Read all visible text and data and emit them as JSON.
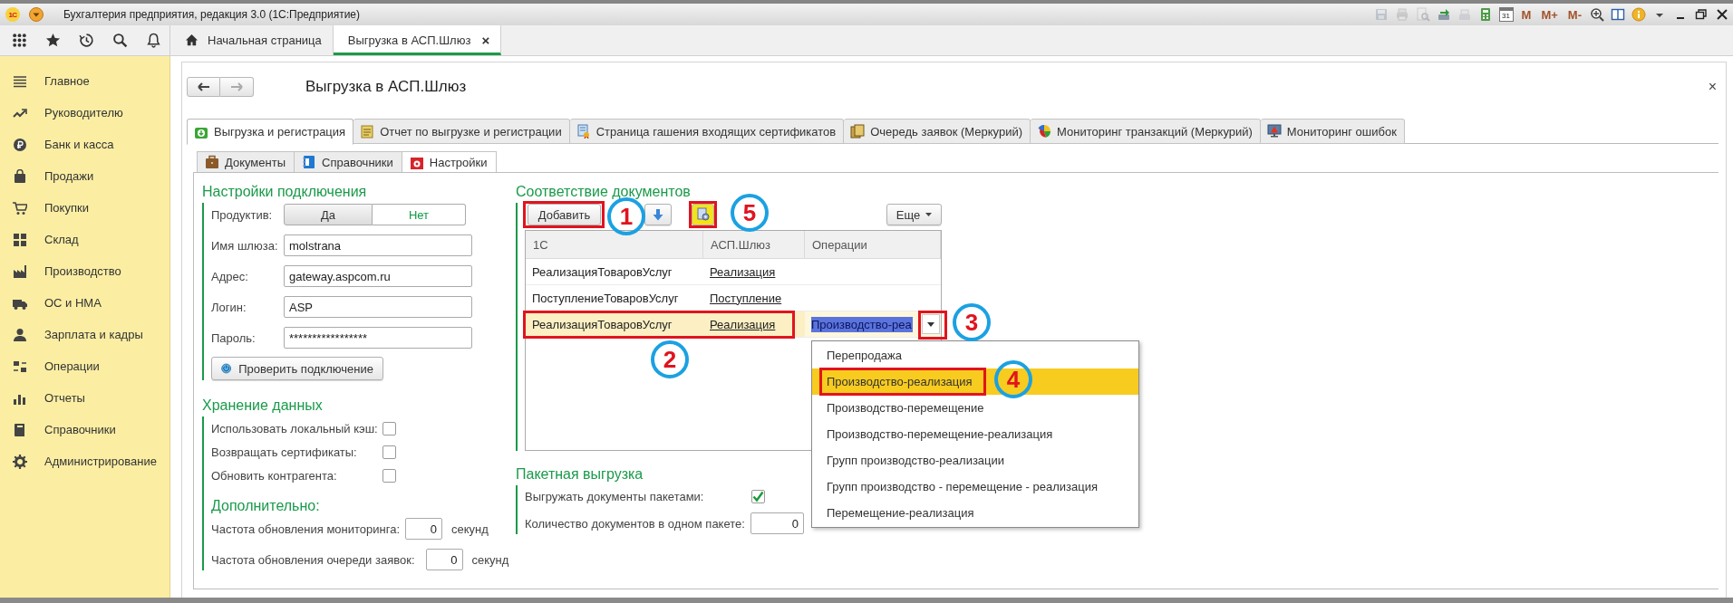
{
  "window": {
    "logo": "1С",
    "title": "Бухгалтерия предприятия, редакция 3.0  (1С:Предприятие)"
  },
  "toolbar": [
    {
      "kind": "save",
      "disabled": true
    },
    {
      "kind": "print",
      "disabled": true
    },
    {
      "kind": "preview",
      "disabled": true
    },
    {
      "kind": "send",
      "disabled": false
    },
    {
      "kind": "scan",
      "disabled": true
    },
    {
      "kind": "calculator",
      "disabled": false
    },
    {
      "kind": "calendar",
      "disabled": false,
      "text": "31"
    },
    {
      "kind": "memory",
      "disabled": false,
      "text": "M"
    },
    {
      "kind": "memory",
      "disabled": false,
      "text": "M+"
    },
    {
      "kind": "memory",
      "disabled": false,
      "text": "M-"
    },
    {
      "kind": "zoom",
      "disabled": false
    },
    {
      "kind": "panels",
      "disabled": false
    },
    {
      "kind": "info",
      "disabled": false
    },
    {
      "kind": "caret",
      "disabled": false
    },
    {
      "kind": "minimize",
      "disabled": false
    },
    {
      "kind": "restore",
      "disabled": false
    },
    {
      "kind": "close",
      "disabled": false
    }
  ],
  "open_tabs": [
    {
      "label": "Начальная страница",
      "kind": "home",
      "selected": false
    },
    {
      "label": "Выгрузка в АСП.Шлюз",
      "kind": "page",
      "selected": true,
      "close": "×"
    }
  ],
  "sidebar": {
    "items": [
      {
        "label": "Главное"
      },
      {
        "label": "Руководителю"
      },
      {
        "label": "Банк и касса"
      },
      {
        "label": "Продажи"
      },
      {
        "label": "Покупки"
      },
      {
        "label": "Склад"
      },
      {
        "label": "Производство"
      },
      {
        "label": "ОС и НМА"
      },
      {
        "label": "Зарплата и кадры"
      },
      {
        "label": "Операции"
      },
      {
        "label": "Отчеты"
      },
      {
        "label": "Справочники"
      },
      {
        "label": "Администрирование"
      }
    ]
  },
  "form": {
    "title": "Выгрузка в АСП.Шлюз",
    "close": "×",
    "tabs": [
      {
        "label": "Выгрузка и регистрация",
        "selected": true
      },
      {
        "label": "Отчет по выгрузке и регистрации",
        "selected": false
      },
      {
        "label": "Страница гашения входящих сертификатов",
        "selected": false
      },
      {
        "label": "Очередь заявок (Меркурий)",
        "selected": false
      },
      {
        "label": "Мониторинг транзакций (Меркурий)",
        "selected": false
      },
      {
        "label": "Мониторинг ошибок",
        "selected": false
      }
    ],
    "subtabs": [
      {
        "label": "Документы",
        "selected": false
      },
      {
        "label": "Справочники",
        "selected": false
      },
      {
        "label": "Настройки",
        "selected": true
      }
    ],
    "connection": {
      "heading": "Настройки подключения",
      "productive": {
        "label": "Продуктив:",
        "options": [
          {
            "label": "Да",
            "selected": true
          },
          {
            "label": "Нет",
            "selected": false
          }
        ]
      },
      "fields": [
        {
          "label": "Имя шлюза:",
          "value": "molstrana"
        },
        {
          "label": "Адрес:",
          "value": "gateway.aspcom.ru"
        },
        {
          "label": "Логин:",
          "value": "ASP"
        },
        {
          "label": "Пароль:",
          "value": "*****************"
        }
      ],
      "check_button": "Проверить подключение"
    },
    "storage": {
      "heading": "Хранение данных",
      "options": [
        {
          "label": "Использовать локальный кэш:",
          "checked": false
        },
        {
          "label": "Возвращать сертификаты:",
          "checked": false
        },
        {
          "label": "Обновить контрагента:",
          "checked": false
        }
      ],
      "extra_heading": "Дополнительно:",
      "intervals": [
        {
          "label": "Частота обновления мониторинга:",
          "value": "0",
          "unit": "секунд"
        },
        {
          "label": "Частота обновления очереди заявок:",
          "value": "0",
          "unit": "секунд"
        }
      ]
    },
    "mapping": {
      "heading": "Соответствие документов",
      "add_button": {
        "label": "Добавить",
        "marked": true
      },
      "settings_button": {
        "marked": true
      },
      "more_button": "Еще",
      "columns": [
        "1С",
        "АСП.Шлюз",
        "Операции"
      ],
      "rows": [
        {
          "cells": [
            "РеализацияТоваровУслуг",
            "Реализация"
          ],
          "selected": false,
          "marked": false
        },
        {
          "cells": [
            "ПоступлениеТоваровУслуг",
            "Поступление"
          ],
          "selected": false,
          "marked": false
        },
        {
          "cells": [
            "РеализацияТоваровУслуг",
            "Реализация"
          ],
          "operation": "Производство-реа",
          "selected": true,
          "marked": true,
          "dropdown_marked": true
        }
      ],
      "operation_options": [
        {
          "label": "Перепродажа",
          "selected": false,
          "marked": false
        },
        {
          "label": "Производство-реализация",
          "selected": true,
          "marked": true
        },
        {
          "label": "Производство-перемещение",
          "selected": false,
          "marked": false
        },
        {
          "label": "Производство-перемещение-реализация",
          "selected": false,
          "marked": false
        },
        {
          "label": "Групп производство-реализации",
          "selected": false,
          "marked": false
        },
        {
          "label": "Групп производство - перемещение - реализация",
          "selected": false,
          "marked": false
        },
        {
          "label": "Перемещение-реализация",
          "selected": false,
          "marked": false
        }
      ]
    },
    "batch": {
      "heading": "Пакетная выгрузка",
      "options": [
        {
          "label": "Выгружать документы пакетами:",
          "checked": true
        }
      ],
      "count": {
        "label": "Количество документов в одном пакете:",
        "value": "0"
      }
    }
  },
  "callouts": [
    "1",
    "2",
    "3",
    "4",
    "5"
  ]
}
